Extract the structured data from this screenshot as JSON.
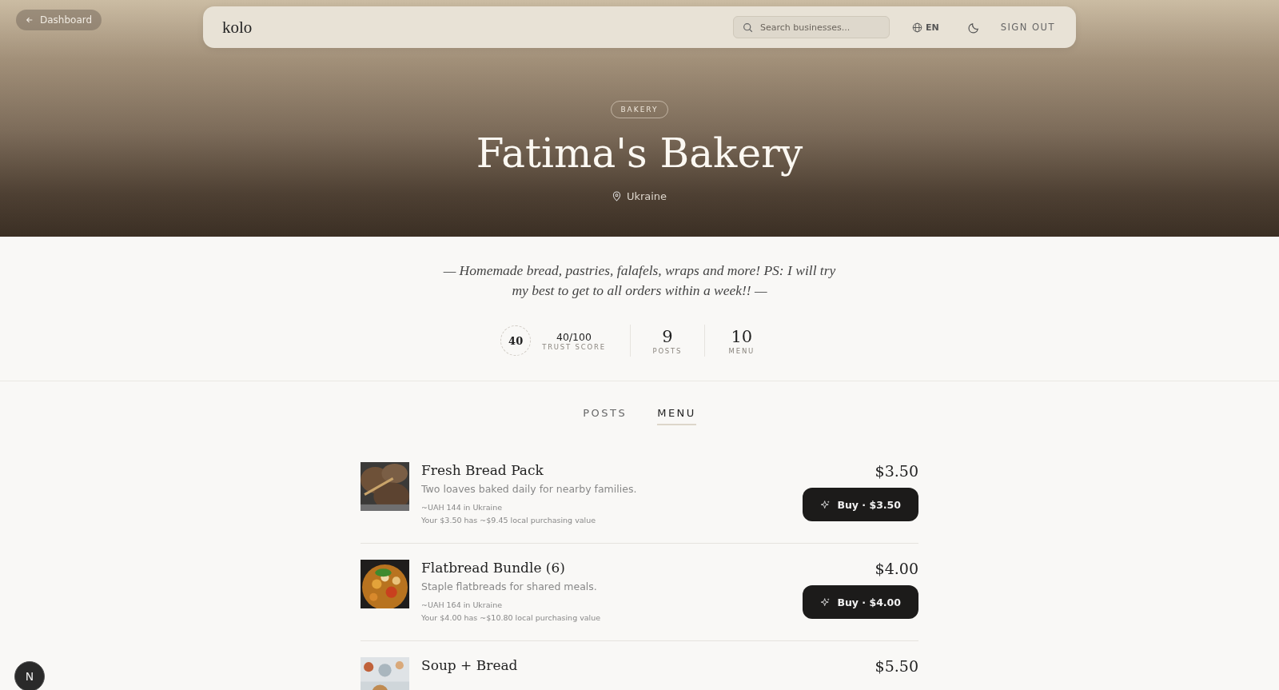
{
  "back_link": {
    "label": "Dashboard"
  },
  "nav": {
    "logo": "kolo",
    "search": {
      "placeholder": "Search businesses..."
    },
    "language": "EN",
    "sign_out": "SIGN OUT"
  },
  "hero": {
    "category": "BAKERY",
    "title": "Fatima's Bakery",
    "location": "Ukraine"
  },
  "description": "— Homemade bread, pastries, falafels, wraps and more! PS: I will try my best to get to all orders within a week!! —",
  "stats": {
    "trust_badge": "40",
    "trust_value": "40/100",
    "trust_label": "TRUST SCORE",
    "items": [
      {
        "value": "9",
        "label": "POSTS"
      },
      {
        "value": "10",
        "label": "MENU"
      }
    ]
  },
  "tabs": [
    {
      "label": "POSTS",
      "selected": false
    },
    {
      "label": "MENU",
      "selected": true
    }
  ],
  "menu_items": [
    {
      "name": "Fresh Bread Pack",
      "description": "Two loaves baked daily for nearby families.",
      "local_price": "~UAH 144 in Ukraine",
      "purchasing_value": "Your $3.50 has ~$9.45 local purchasing value",
      "price": "$3.50",
      "button": "Buy · $3.50"
    },
    {
      "name": "Flatbread Bundle (6)",
      "description": "Staple flatbreads for shared meals.",
      "local_price": "~UAH 164 in Ukraine",
      "purchasing_value": "Your $4.00 has ~$10.80 local purchasing value",
      "price": "$4.00",
      "button": "Buy · $4.00"
    },
    {
      "name": "Soup + Bread",
      "price": "$5.50"
    }
  ],
  "dev_badge": "N"
}
